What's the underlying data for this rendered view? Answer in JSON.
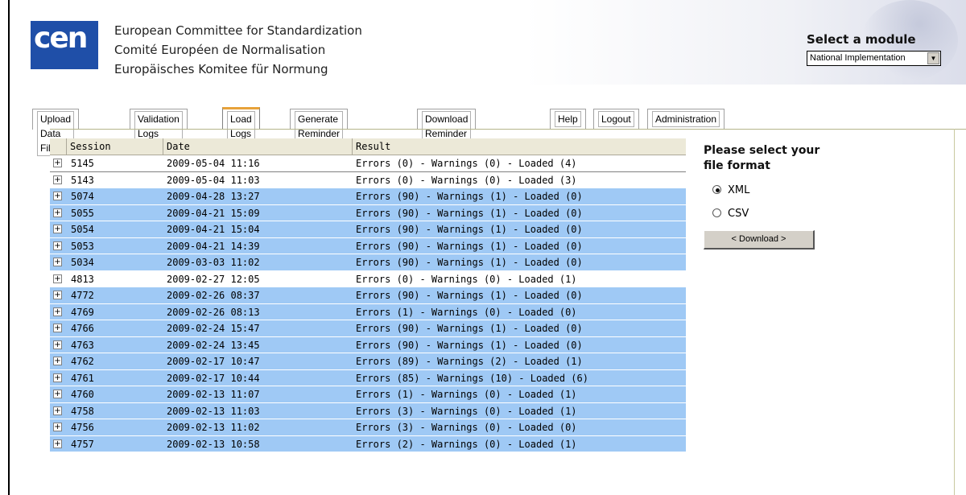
{
  "header": {
    "logo_text": "cen",
    "org_names": [
      "European Committee for Standardization",
      "Comité Européen de Normalisation",
      "Europäisches Komitee für Normung"
    ],
    "module_label": "Select a module",
    "module_selected": "National Implementation"
  },
  "tabs": [
    {
      "label": "Upload Data File",
      "active": false
    },
    {
      "label": "Validation Logs",
      "active": false
    },
    {
      "label": "Load Logs",
      "active": true
    },
    {
      "label": "Generate Reminder File",
      "active": false
    },
    {
      "label": "Download Reminder File",
      "active": false
    },
    {
      "label": "Help",
      "active": false
    },
    {
      "label": "Logout",
      "active": false
    },
    {
      "label": "Administration",
      "active": false
    }
  ],
  "grid": {
    "columns": [
      "Session",
      "Date",
      "Result"
    ],
    "expand_glyph": "+",
    "rows": [
      {
        "session": "5145",
        "date": "2009-05-04 11:16",
        "result": "Errors (0) - Warnings (0) - Loaded (4)",
        "highlight": false
      },
      {
        "session": "5143",
        "date": "2009-05-04 11:03",
        "result": "Errors (0) - Warnings (0) - Loaded (3)",
        "highlight": false
      },
      {
        "session": "5074",
        "date": "2009-04-28 13:27",
        "result": "Errors (90) - Warnings (1) - Loaded (0)",
        "highlight": true
      },
      {
        "session": "5055",
        "date": "2009-04-21 15:09",
        "result": "Errors (90) - Warnings (1) - Loaded (0)",
        "highlight": true
      },
      {
        "session": "5054",
        "date": "2009-04-21 15:04",
        "result": "Errors (90) - Warnings (1) - Loaded (0)",
        "highlight": true
      },
      {
        "session": "5053",
        "date": "2009-04-21 14:39",
        "result": "Errors (90) - Warnings (1) - Loaded (0)",
        "highlight": true
      },
      {
        "session": "5034",
        "date": "2009-03-03 11:02",
        "result": "Errors (90) - Warnings (1) - Loaded (0)",
        "highlight": true
      },
      {
        "session": "4813",
        "date": "2009-02-27 12:05",
        "result": "Errors (0) - Warnings (0) - Loaded (1)",
        "highlight": false
      },
      {
        "session": "4772",
        "date": "2009-02-26 08:37",
        "result": "Errors (90) - Warnings (1) - Loaded (0)",
        "highlight": true
      },
      {
        "session": "4769",
        "date": "2009-02-26 08:13",
        "result": "Errors (1) - Warnings (0) - Loaded (0)",
        "highlight": true
      },
      {
        "session": "4766",
        "date": "2009-02-24 15:47",
        "result": "Errors (90) - Warnings (1) - Loaded (0)",
        "highlight": true
      },
      {
        "session": "4763",
        "date": "2009-02-24 13:45",
        "result": "Errors (90) - Warnings (1) - Loaded (0)",
        "highlight": true
      },
      {
        "session": "4762",
        "date": "2009-02-17 10:47",
        "result": "Errors (89) - Warnings (2) - Loaded (1)",
        "highlight": true
      },
      {
        "session": "4761",
        "date": "2009-02-17 10:44",
        "result": "Errors (85) - Warnings (10) - Loaded (6)",
        "highlight": true
      },
      {
        "session": "4760",
        "date": "2009-02-13 11:07",
        "result": "Errors (1) - Warnings (0) - Loaded (1)",
        "highlight": true
      },
      {
        "session": "4758",
        "date": "2009-02-13 11:03",
        "result": "Errors (3) - Warnings (0) - Loaded (1)",
        "highlight": true
      },
      {
        "session": "4756",
        "date": "2009-02-13 11:02",
        "result": "Errors (3) - Warnings (0) - Loaded (0)",
        "highlight": true
      },
      {
        "session": "4757",
        "date": "2009-02-13 10:58",
        "result": "Errors (2) - Warnings (0) - Loaded (1)",
        "highlight": true
      }
    ]
  },
  "format_panel": {
    "title_line1": "Please select your",
    "title_line2": "file format",
    "options": [
      {
        "label": "XML",
        "checked": true
      },
      {
        "label": "CSV",
        "checked": false
      }
    ],
    "download_label": "< Download >"
  },
  "colors": {
    "row_highlight": "#9fc9f5",
    "logo_blue": "#1f4fa8",
    "active_tab_accent": "#e8a23a"
  }
}
